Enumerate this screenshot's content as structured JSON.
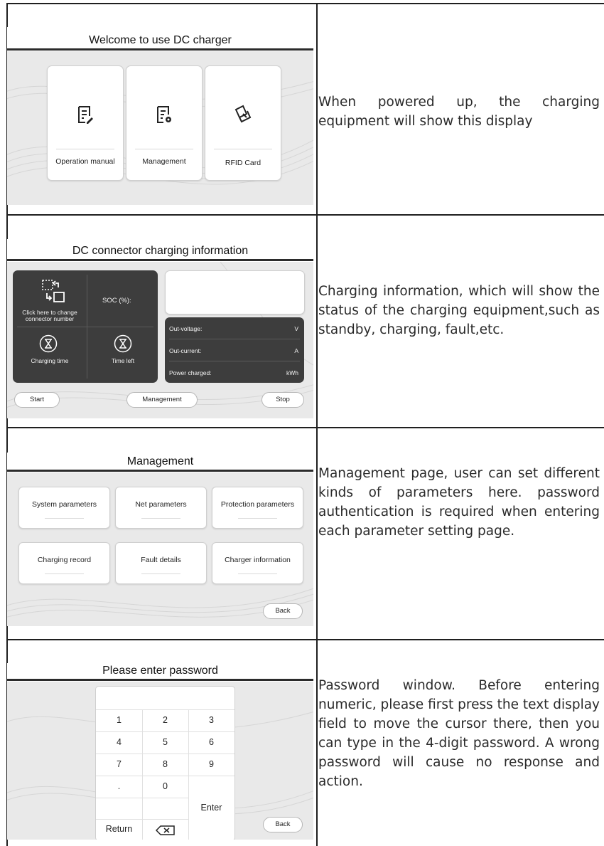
{
  "rows": [
    {
      "screen": {
        "title": "Welcome to use DC charger",
        "cards": [
          {
            "label": "Operation manual",
            "icon": "document-pen-icon"
          },
          {
            "label": "Management",
            "icon": "document-gear-icon"
          },
          {
            "label": "RFID Card",
            "icon": "rfid-card-icon"
          }
        ]
      },
      "description": "When powered up, the charging equipment will show this display"
    },
    {
      "screen": {
        "title": "DC connector charging information",
        "change_connector": "Click here to change connector number",
        "soc_label": "SOC (%):",
        "charging_time_label": "Charging time",
        "time_left_label": "Time left",
        "readings": [
          {
            "label": "Out-voltage:",
            "unit": "V"
          },
          {
            "label": "Out-current:",
            "unit": "A"
          },
          {
            "label": "Power charged:",
            "unit": "kWh"
          }
        ],
        "buttons": {
          "start": "Start",
          "management": "Management",
          "stop": "Stop"
        }
      },
      "description": "Charging information, which will show the status of the charging equipment,such as standby, charging, fault,etc."
    },
    {
      "screen": {
        "title": "Management",
        "items": [
          "System parameters",
          "Net parameters",
          "Protection parameters",
          "Charging record",
          "Fault details",
          "Charger information"
        ],
        "back": "Back"
      },
      "description": "Management page, user can set different kinds of parameters here. password authentication is required when entering each parameter setting page."
    },
    {
      "screen": {
        "title": "Please enter password",
        "keys": [
          "1",
          "2",
          "3",
          "4",
          "5",
          "6",
          "7",
          "8",
          "9",
          ".",
          "0"
        ],
        "enter": "Enter",
        "return": "Return",
        "back": "Back"
      },
      "description": "Password window. Before entering numeric, please first press the text display field to move the cursor there, then you can type in the 4-digit password. A wrong password will cause no response and action."
    }
  ]
}
